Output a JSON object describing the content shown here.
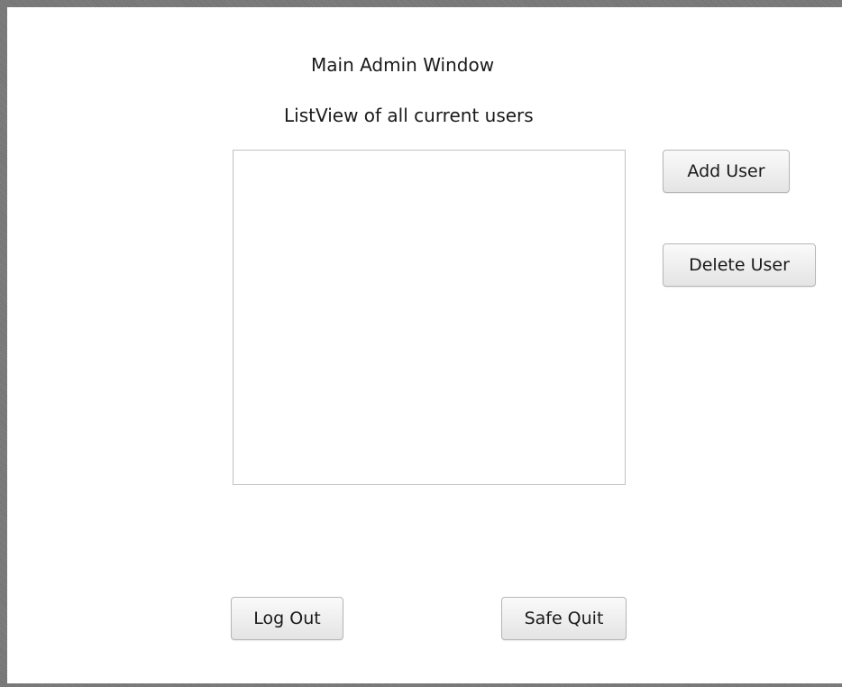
{
  "window": {
    "title_label": "Main Admin Window",
    "subtitle_label": "ListView of all current users"
  },
  "user_list": {
    "items": []
  },
  "buttons": {
    "add_user": "Add User",
    "delete_user": "Delete User",
    "log_out": "Log Out",
    "safe_quit": "Safe Quit"
  }
}
